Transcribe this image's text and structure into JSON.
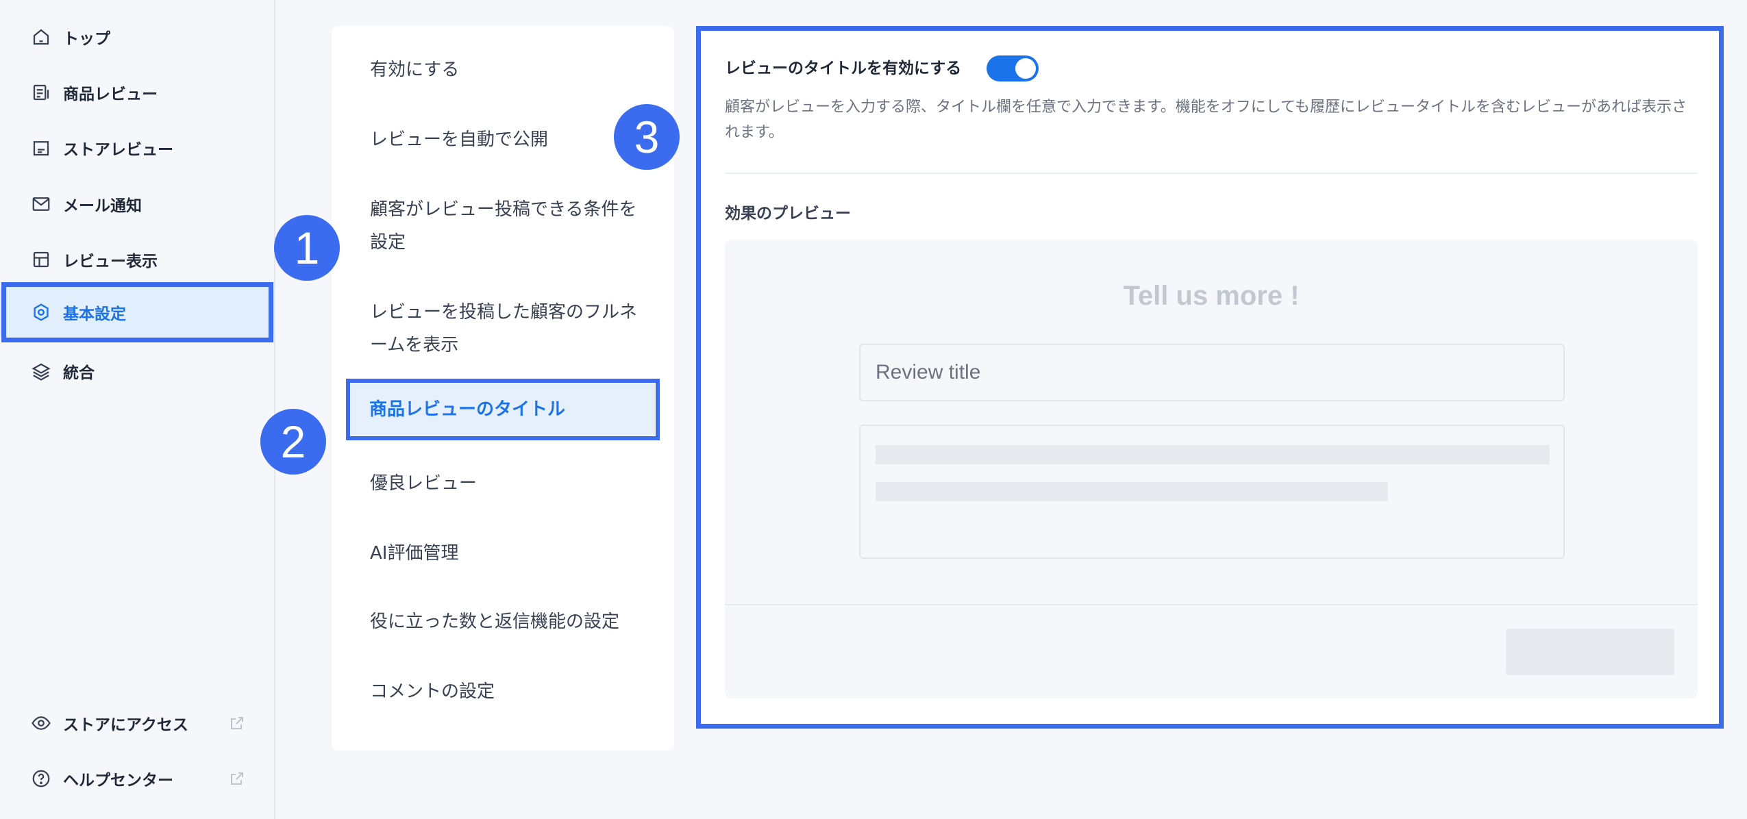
{
  "sidebar": {
    "items": [
      {
        "label": "トップ",
        "icon": "home-icon"
      },
      {
        "label": "商品レビュー",
        "icon": "product-review-icon"
      },
      {
        "label": "ストアレビュー",
        "icon": "store-icon"
      },
      {
        "label": "メール通知",
        "icon": "mail-icon"
      },
      {
        "label": "レビュー表示",
        "icon": "layout-icon"
      },
      {
        "label": "基本設定",
        "icon": "settings-icon",
        "active": true
      },
      {
        "label": "統合",
        "icon": "layers-icon"
      }
    ],
    "footer": [
      {
        "label": "ストアにアクセス",
        "icon": "eye-icon"
      },
      {
        "label": "ヘルプセンター",
        "icon": "help-icon"
      }
    ]
  },
  "menu": {
    "items": [
      {
        "label": "有効にする"
      },
      {
        "label": "レビューを自動で公開"
      },
      {
        "label": "顧客がレビュー投稿できる条件を設定"
      },
      {
        "label": "レビューを投稿した顧客のフルネームを表示"
      },
      {
        "label": "商品レビューのタイトル",
        "active": true
      },
      {
        "label": "優良レビュー"
      },
      {
        "label": "AI評価管理"
      },
      {
        "label": "役に立った数と返信機能の設定"
      },
      {
        "label": "コメントの設定"
      }
    ]
  },
  "badges": [
    "1",
    "2",
    "3"
  ],
  "panel": {
    "toggle_label": "レビューのタイトルを有効にする",
    "toggle_on": true,
    "description": "顧客がレビューを入力する際、タイトル欄を任意で入力できます。機能をオフにしても履歴にレビュータイトルを含むレビューがあれば表示されます。",
    "preview_label": "効果のプレビュー",
    "preview": {
      "heading": "Tell us more !",
      "title_placeholder": "Review title"
    }
  },
  "colors": {
    "accent": "#1a73e8",
    "annotation": "#3b6cf0",
    "active_bg": "#e1eefc"
  }
}
